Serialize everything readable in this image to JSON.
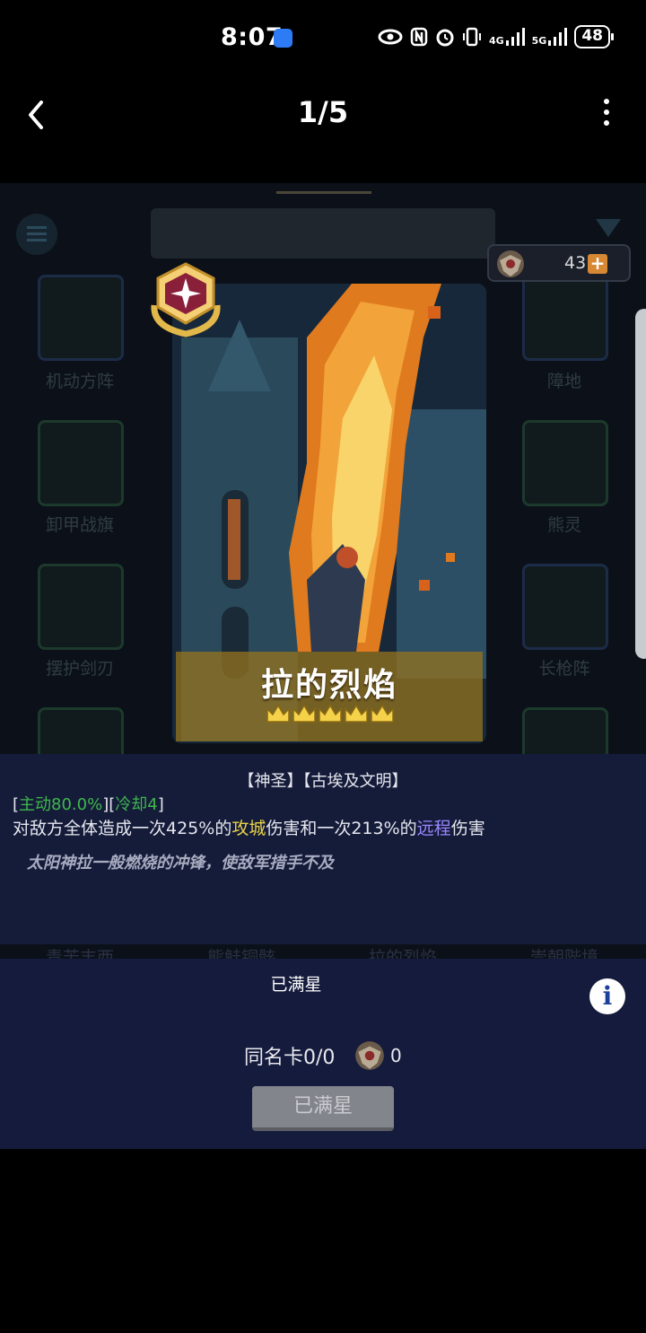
{
  "status_bar": {
    "time": "8:07",
    "battery": "48",
    "network_4g": "4G",
    "network_5g": "5G"
  },
  "nav": {
    "title": "1/5"
  },
  "game": {
    "medal_count": "43",
    "plus_label": "+",
    "slot_labels_left": [
      "机动方阵",
      "卸甲战旗",
      "摆护剑刃"
    ],
    "slot_labels_right": [
      "障地",
      "熊灵",
      "长枪阵"
    ],
    "faded_labels": [
      "青苦丰西",
      "熊鲑铜骸",
      "拉的烈焰",
      "崇朝陛境"
    ],
    "card": {
      "name": "拉的烈焰",
      "stars": 5
    },
    "description": {
      "tags": "【神圣】【古埃及文明】",
      "meta_open": "[",
      "active": "主动80.0%",
      "meta_mid": "][",
      "cooldown": "冷却4",
      "meta_close": "]",
      "effect_part1": "对敌方全体造成一次425%的",
      "effect_kw1": "攻城",
      "effect_part2": "伤害和一次213%的",
      "effect_kw2": "远程",
      "effect_part3": "伤害",
      "flavor": "太阳神拉一般燃烧的冲锋，使敌军措手不及"
    },
    "lower": {
      "max_star_label": "已满星",
      "info_icon": "i",
      "dup_card": "同名卡0/0",
      "dup_medal_count": "0",
      "max_star_button": "已满星"
    }
  }
}
